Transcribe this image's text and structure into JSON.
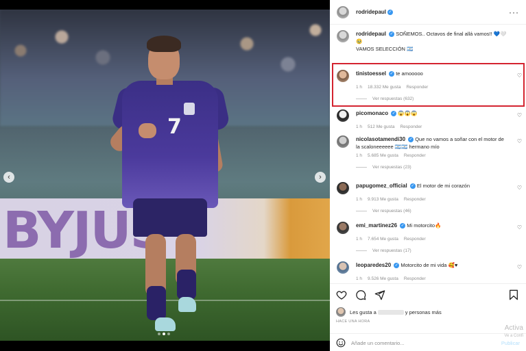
{
  "post": {
    "author": "rodridepaul",
    "more": "···",
    "caption_line1": "SOÑEMOS.. Octavos de final allá vamos!! 💙🤍",
    "caption_emoji": "🥹",
    "caption_line2": "VAMOS SELECCIÓN 🇦🇷",
    "carousel": {
      "prev": "‹",
      "next": "›",
      "dots": 3,
      "active_dot": 1
    },
    "photo_board_text": "BYJUS"
  },
  "comments": [
    {
      "user": "tinistoessel",
      "text": "te amooooo",
      "time": "1 h",
      "likes": "18.332 Me gusta",
      "reply": "Responder",
      "replies": "Ver respuestas (632)"
    },
    {
      "user": "picomonaco",
      "text": "😱😱😱",
      "time": "1 h",
      "likes": "512 Me gusta",
      "reply": "Responder"
    },
    {
      "user": "nicolasotamendi30",
      "text": "Que no vamos a soñar con el motor de la scaloneeeeee 🇦🇷🇦🇷 hermano mío",
      "time": "1 h",
      "likes": "5.685 Me gusta",
      "reply": "Responder",
      "replies": "Ver respuestas (23)"
    },
    {
      "user": "papugomez_official",
      "text": "El motor de mi corazón",
      "time": "1 h",
      "likes": "9.913 Me gusta",
      "reply": "Responder",
      "replies": "Ver respuestas (46)"
    },
    {
      "user": "emi_martinez26",
      "text": "Mi motorcito🔥",
      "time": "1 h",
      "likes": "7.654 Me gusta",
      "reply": "Responder",
      "replies": "Ver respuestas (17)"
    },
    {
      "user": "leoparedes20",
      "text": "Motorcito de mi vida 🥰♥",
      "time": "1 h",
      "likes": "9.526 Me gusta",
      "reply": "Responder"
    }
  ],
  "footer": {
    "likes_prefix": "Les gusta a",
    "likes_suffix": "y personas más",
    "ago": "HACE UNA HORA",
    "add_placeholder": "Añade un comentario...",
    "publish": "Publicar",
    "watermark": "Activa",
    "watermark2": "Ve a Confi"
  },
  "colors": {
    "verified": "#3897f0",
    "highlight": "#d4232f",
    "jersey": "#3b2f86"
  }
}
